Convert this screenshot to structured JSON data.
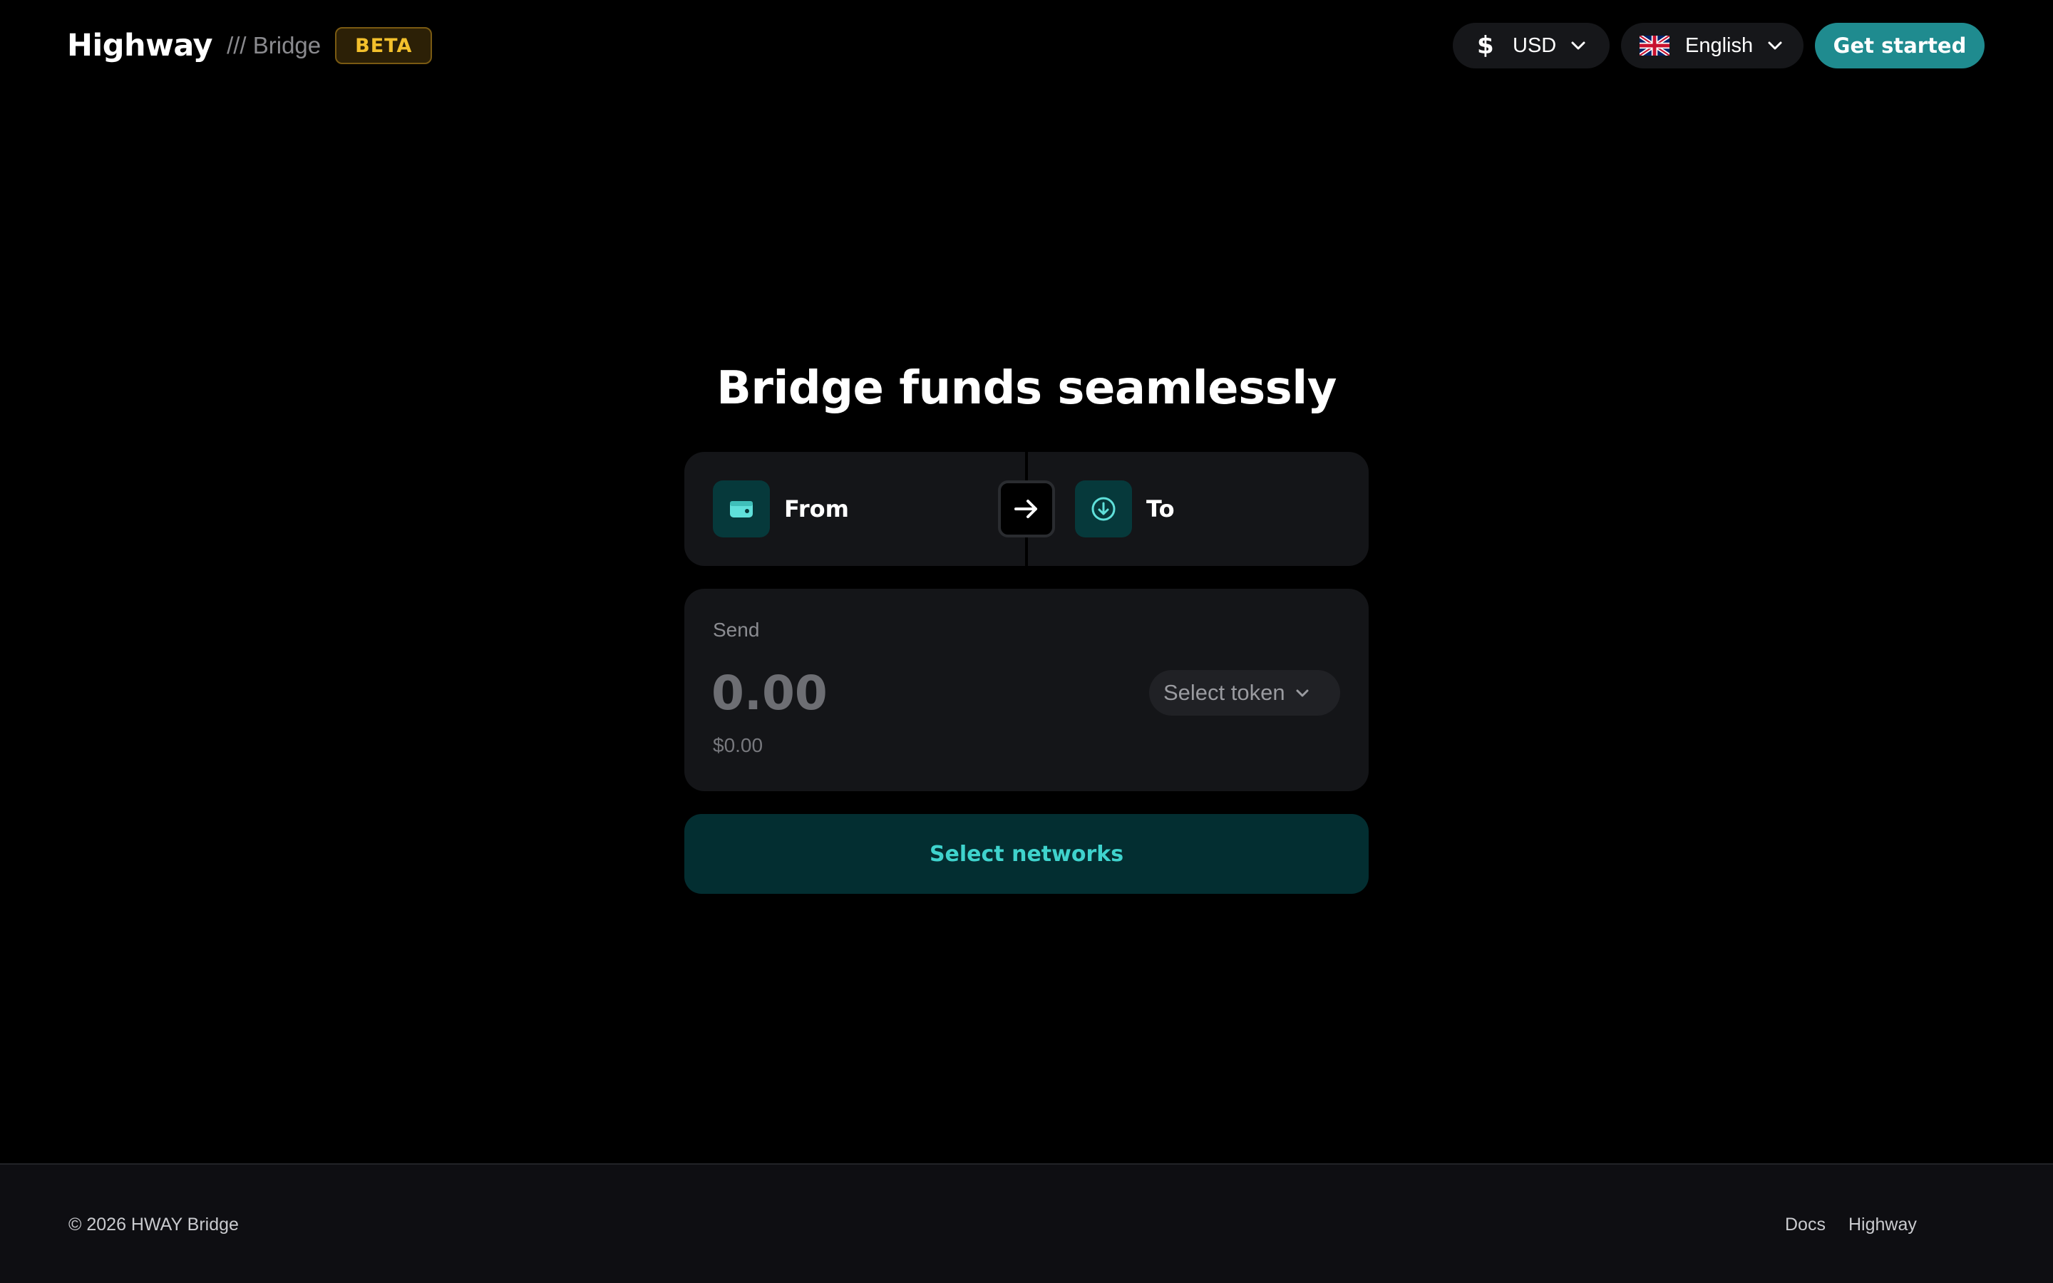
{
  "header": {
    "logo_text": "Highway",
    "product_label": "/// Bridge",
    "badge": "BETA",
    "currency": {
      "icon": "dollar-icon",
      "label": "USD"
    },
    "language": {
      "icon": "uk-flag-icon",
      "label": "English"
    },
    "cta_label": "Get started"
  },
  "main": {
    "title": "Bridge funds seamlessly",
    "networks": {
      "from_label": "From",
      "from_icon": "wallet-icon",
      "to_label": "To",
      "to_icon": "arrow-down-circle-icon",
      "swap_icon": "arrow-right-icon"
    },
    "send": {
      "label": "Send",
      "amount_placeholder": "0.00",
      "usd_value": "$0.00",
      "token_select_label": "Select token"
    },
    "primary_action": "Select networks"
  },
  "footer": {
    "copyright": "© 2026 HWAY Bridge",
    "links": [
      "Docs",
      "Highway"
    ]
  },
  "colors": {
    "background": "#000000",
    "card": "#141518",
    "accent": "#1f8b8f",
    "accent_text": "#3fd3cd",
    "beta": "#f3c02c"
  }
}
